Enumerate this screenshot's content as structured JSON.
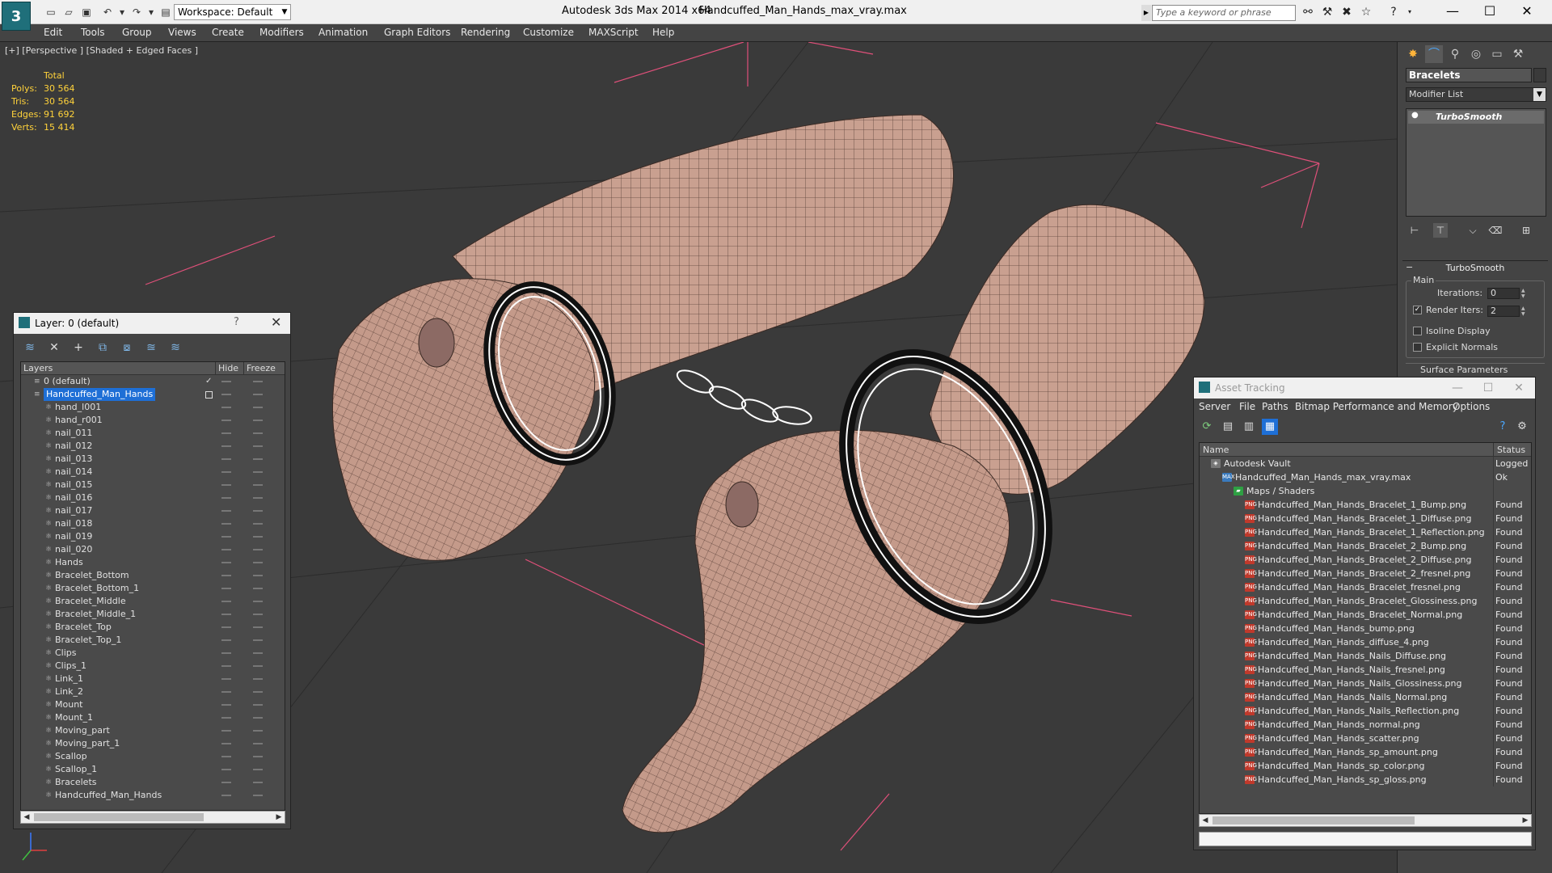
{
  "titlebar": {
    "logo": "3",
    "workspace": "Workspace: Default",
    "app_title": "Autodesk 3ds Max  2014 x64",
    "file_title": "Handcuffed_Man_Hands_max_vray.max",
    "search_placeholder": "Type a keyword or phrase",
    "minimize": "—",
    "maximize": "☐",
    "close": "✕"
  },
  "menu": [
    "Edit",
    "Tools",
    "Group",
    "Views",
    "Create",
    "Modifiers",
    "Animation",
    "Graph Editors",
    "Rendering",
    "Customize",
    "MAXScript",
    "Help"
  ],
  "viewport": {
    "label": "[+] [Perspective ] [Shaded + Edged Faces ]",
    "stats": {
      "header": "Total",
      "rows": [
        {
          "label": "Polys:",
          "value": "30 564"
        },
        {
          "label": "Tris:",
          "value": "30 564"
        },
        {
          "label": "Edges:",
          "value": "91 692"
        },
        {
          "label": "Verts:",
          "value": "15 414"
        }
      ]
    },
    "colors": {
      "background": "#3a3a3a",
      "skin": "#caa192",
      "wire": "#4a3a34",
      "grid_pink": "#e0507a"
    }
  },
  "layer_panel": {
    "title": "Layer: 0 (default)",
    "help": "?",
    "close": "✕",
    "col_layers": "Layers",
    "col_hide": "Hide",
    "col_freeze": "Freeze",
    "rows": [
      {
        "name": "0 (default)",
        "level": 0
      },
      {
        "name": "Handcuffed_Man_Hands",
        "level": 0
      },
      {
        "name": "hand_l001",
        "level": 1
      },
      {
        "name": "hand_r001",
        "level": 1
      },
      {
        "name": "nail_011",
        "level": 1
      },
      {
        "name": "nail_012",
        "level": 1
      },
      {
        "name": "nail_013",
        "level": 1
      },
      {
        "name": "nail_014",
        "level": 1
      },
      {
        "name": "nail_015",
        "level": 1
      },
      {
        "name": "nail_016",
        "level": 1
      },
      {
        "name": "nail_017",
        "level": 1
      },
      {
        "name": "nail_018",
        "level": 1
      },
      {
        "name": "nail_019",
        "level": 1
      },
      {
        "name": "nail_020",
        "level": 1
      },
      {
        "name": "Hands",
        "level": 1
      },
      {
        "name": "Bracelet_Bottom",
        "level": 1
      },
      {
        "name": "Bracelet_Bottom_1",
        "level": 1
      },
      {
        "name": "Bracelet_Middle",
        "level": 1
      },
      {
        "name": "Bracelet_Middle_1",
        "level": 1
      },
      {
        "name": "Bracelet_Top",
        "level": 1
      },
      {
        "name": "Bracelet_Top_1",
        "level": 1
      },
      {
        "name": "Clips",
        "level": 1
      },
      {
        "name": "Clips_1",
        "level": 1
      },
      {
        "name": "Link_1",
        "level": 1
      },
      {
        "name": "Link_2",
        "level": 1
      },
      {
        "name": "Mount",
        "level": 1
      },
      {
        "name": "Mount_1",
        "level": 1
      },
      {
        "name": "Moving_part",
        "level": 1
      },
      {
        "name": "Moving_part_1",
        "level": 1
      },
      {
        "name": "Scallop",
        "level": 1
      },
      {
        "name": "Scallop_1",
        "level": 1
      },
      {
        "name": "Bracelets",
        "level": 1
      },
      {
        "name": "Handcuffed_Man_Hands",
        "level": 1
      }
    ]
  },
  "command_panel": {
    "object_name": "Bracelets",
    "modifier_list": "Modifier List",
    "stack_item": "TurboSmooth",
    "turbosmooth": {
      "title": "TurboSmooth",
      "group_main": "Main",
      "iterations_label": "Iterations:",
      "iterations_value": "0",
      "render_iters_label": "Render Iters:",
      "render_iters_value": "2",
      "render_iters_checked": "✓",
      "isoline_label": "Isoline Display",
      "explicit_label": "Explicit Normals",
      "surface_params": "Surface Parameters"
    }
  },
  "asset_panel": {
    "title": "Asset Tracking",
    "menu": [
      "Server",
      "File",
      "Paths",
      "Bitmap Performance and Memory",
      "Options"
    ],
    "col_name": "Name",
    "col_status": "Status",
    "rows": [
      {
        "name": "Autodesk Vault",
        "status": "Logged O",
        "type": "vault",
        "level": 0
      },
      {
        "name": "Handcuffed_Man_Hands_max_vray.max",
        "status": "Ok",
        "type": "max",
        "level": 1
      },
      {
        "name": "Maps / Shaders",
        "status": "",
        "type": "folder",
        "level": 2
      },
      {
        "name": "Handcuffed_Man_Hands_Bracelet_1_Bump.png",
        "status": "Found",
        "type": "png",
        "level": 3
      },
      {
        "name": "Handcuffed_Man_Hands_Bracelet_1_Diffuse.png",
        "status": "Found",
        "type": "png",
        "level": 3
      },
      {
        "name": "Handcuffed_Man_Hands_Bracelet_1_Reflection.png",
        "status": "Found",
        "type": "png",
        "level": 3
      },
      {
        "name": "Handcuffed_Man_Hands_Bracelet_2_Bump.png",
        "status": "Found",
        "type": "png",
        "level": 3
      },
      {
        "name": "Handcuffed_Man_Hands_Bracelet_2_Diffuse.png",
        "status": "Found",
        "type": "png",
        "level": 3
      },
      {
        "name": "Handcuffed_Man_Hands_Bracelet_2_fresnel.png",
        "status": "Found",
        "type": "png",
        "level": 3
      },
      {
        "name": "Handcuffed_Man_Hands_Bracelet_fresnel.png",
        "status": "Found",
        "type": "png",
        "level": 3
      },
      {
        "name": "Handcuffed_Man_Hands_Bracelet_Glossiness.png",
        "status": "Found",
        "type": "png",
        "level": 3
      },
      {
        "name": "Handcuffed_Man_Hands_Bracelet_Normal.png",
        "status": "Found",
        "type": "png",
        "level": 3
      },
      {
        "name": "Handcuffed_Man_Hands_bump.png",
        "status": "Found",
        "type": "png",
        "level": 3
      },
      {
        "name": "Handcuffed_Man_Hands_diffuse_4.png",
        "status": "Found",
        "type": "png",
        "level": 3
      },
      {
        "name": "Handcuffed_Man_Hands_Nails_Diffuse.png",
        "status": "Found",
        "type": "png",
        "level": 3
      },
      {
        "name": "Handcuffed_Man_Hands_Nails_fresnel.png",
        "status": "Found",
        "type": "png",
        "level": 3
      },
      {
        "name": "Handcuffed_Man_Hands_Nails_Glossiness.png",
        "status": "Found",
        "type": "png",
        "level": 3
      },
      {
        "name": "Handcuffed_Man_Hands_Nails_Normal.png",
        "status": "Found",
        "type": "png",
        "level": 3
      },
      {
        "name": "Handcuffed_Man_Hands_Nails_Reflection.png",
        "status": "Found",
        "type": "png",
        "level": 3
      },
      {
        "name": "Handcuffed_Man_Hands_normal.png",
        "status": "Found",
        "type": "png",
        "level": 3
      },
      {
        "name": "Handcuffed_Man_Hands_scatter.png",
        "status": "Found",
        "type": "png",
        "level": 3
      },
      {
        "name": "Handcuffed_Man_Hands_sp_amount.png",
        "status": "Found",
        "type": "png",
        "level": 3
      },
      {
        "name": "Handcuffed_Man_Hands_sp_color.png",
        "status": "Found",
        "type": "png",
        "level": 3
      },
      {
        "name": "Handcuffed_Man_Hands_sp_gloss.png",
        "status": "Found",
        "type": "png",
        "level": 3
      }
    ]
  }
}
